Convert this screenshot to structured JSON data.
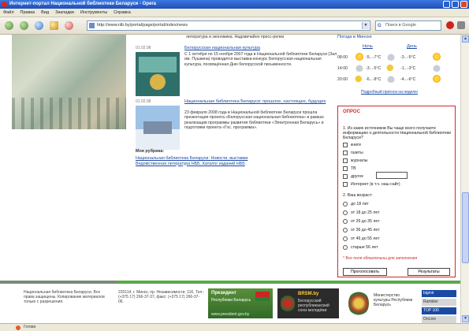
{
  "window": {
    "title": "Интернет-портал Национальной библиотеки Беларуси - Opera"
  },
  "menu": {
    "items": [
      "Файл",
      "Правка",
      "Вид",
      "Закладки",
      "Инструменты",
      "Справка"
    ]
  },
  "toolbar": {
    "address": "http://www.nlb.by/portal/page/portal/index/news",
    "search_engine": "G",
    "search_placeholder": "Поиск в Google"
  },
  "main": {
    "intro_text": "литература и экономика. Надзвичайно пресс-релиз",
    "news": [
      {
        "date": "01.02.08",
        "title": "Белорусская национальная культура",
        "body": "С 1 октября по 15 ноября 2007 года в Национальной библиотеке Беларуси (Зал им. Пушкина) проводится выставка-конкурс Белорусская национальная культура, посвящённая Дню белорусской письменности."
      },
      {
        "date": "01.02.08",
        "title": "Национальная библиотека Беларуси: прошлое, настоящее, будущее",
        "body": "23 февраля 2008 года в Национальной библиотеке Беларуси прошла презентация проекта «Белорусская национальная библиотека» в рамках реализации программы развития библиотеки «Электронная Беларусь» и подготовки проекта «Гос. программа»."
      }
    ],
    "subsection": {
      "header": "Моя рубрика:",
      "links": [
        "Национальная библиотека Беларуси: Новости, выставки",
        "Ведомственная литература НББ. Каталог изданий НББ"
      ]
    }
  },
  "weather": {
    "title": "Погода в Минске",
    "col_today": "Ночь",
    "col_tomorrow": "День",
    "rows": [
      {
        "time": "08:00",
        "today": "-5...-7°C",
        "tomorrow": "-3...-5°C"
      },
      {
        "time": "14:00",
        "today": "-3...-5°C",
        "tomorrow": "-1...-3°C"
      },
      {
        "time": "20:00",
        "today": "-6...-8°C",
        "tomorrow": "-4...-6°C"
      }
    ],
    "link": "Подробный прогноз на неделю"
  },
  "poll": {
    "title": "ОПРОС",
    "q1": "1. Из каких источников Вы чаще всего получаете информацию о деятельности Национальной библиотеки Беларуси?",
    "q1_options": [
      "книги",
      "газеты",
      "журналы",
      "ТВ",
      "другое",
      "Интернет (в т.ч. наш сайт)"
    ],
    "q2": "2. Ваш возраст:",
    "q2_options": [
      "до 18 лет",
      "от 18 до 25 лет",
      "от 26 до 35 лет",
      "от 36 до 45 лет",
      "от 46 до 55 лет",
      "старше 56 лет"
    ],
    "note": "* Все поля обязательны для заполнения",
    "vote_button": "Проголосовать",
    "results_button": "Результаты"
  },
  "footer": {
    "text1": "Национальная библиотека Беларуси. Все права защищены. Копирование материалов только с разрешения.",
    "text2": "220114, г. Минск, пр. Независимости, 116. Тел.: (+375 17) 266-37-37, факс: (+375 17) 266-37-06.",
    "counter": "Счётчик посещений",
    "banner_president": {
      "title": "Президент",
      "subtitle": "Республики Беларусь",
      "url": "www.president.gov.by"
    },
    "banner_brsm": {
      "title": "BRSM.by",
      "subtitle": "Белорусский республиканский союз молодёжи"
    },
    "banner_ministry": "Министерство культуры Республики Беларусь",
    "badges": [
      "bigmir",
      "Rambler",
      "TOP 100",
      "OnLine"
    ]
  },
  "statusbar": {
    "text": "Готово"
  }
}
